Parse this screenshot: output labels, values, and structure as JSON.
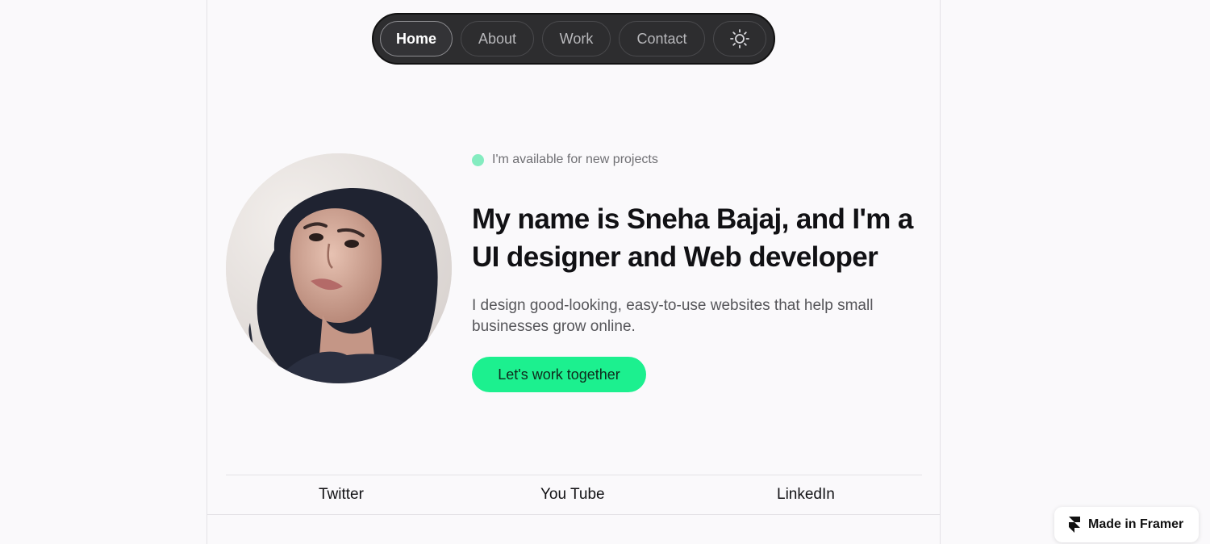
{
  "nav": {
    "items": [
      {
        "label": "Home",
        "active": true
      },
      {
        "label": "About",
        "active": false
      },
      {
        "label": "Work",
        "active": false
      },
      {
        "label": "Contact",
        "active": false
      }
    ],
    "theme_toggle_icon": "sun-icon"
  },
  "hero": {
    "availability": "I'm available for new projects",
    "headline": "My name is Sneha Bajaj, and I'm a UI designer and Web developer",
    "subtext": "I design good-looking, easy-to-use websites that help small businesses grow online.",
    "cta_label": "Let's work together"
  },
  "social": {
    "links": [
      "Twitter",
      "You Tube",
      "LinkedIn"
    ]
  },
  "badge": {
    "label": "Made in Framer",
    "icon": "framer-logo-icon"
  },
  "colors": {
    "accent": "#1cf08f",
    "status": "#84ecc0",
    "nav_bg": "#2d2d2f",
    "page_bg": "#faf9fb"
  }
}
